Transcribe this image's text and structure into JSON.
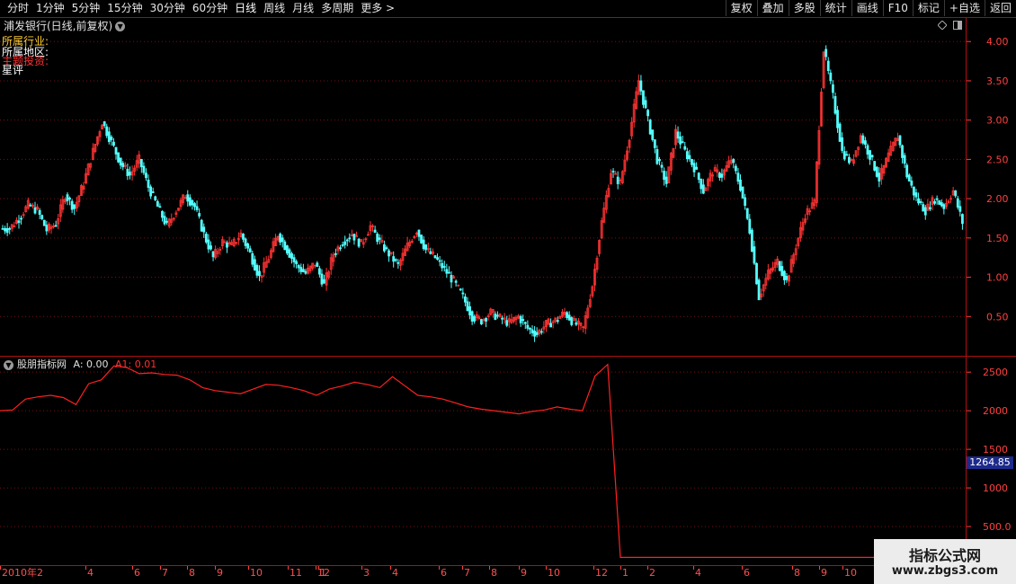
{
  "toolbar": {
    "periods": [
      "分时",
      "1分钟",
      "5分钟",
      "15分钟",
      "30分钟",
      "60分钟",
      "日线",
      "周线",
      "月线",
      "多周期",
      "更多 >"
    ],
    "active_period": "日线",
    "actions": [
      "复权",
      "叠加",
      "多股",
      "统计",
      "画线",
      "F10",
      "标记",
      "+自选",
      "返回"
    ]
  },
  "main": {
    "title": "浦发银行(日线,前复权)",
    "info_lines": [
      {
        "text": "所属行业:",
        "color": "#ffcc33"
      },
      {
        "text": "所属地区:",
        "color": "#ffffff"
      },
      {
        "text": "主题投资:",
        "color": "#ff3030"
      },
      {
        "text": "星评",
        "color": "#ffffff"
      }
    ]
  },
  "indicator": {
    "name": "股朋指标网",
    "a_label": "A: 0.00",
    "a1_label": "A1: 0.01"
  },
  "price_axis": {
    "ticks": [
      "4.00",
      "3.50",
      "3.00",
      "2.50",
      "2.00",
      "1.50",
      "1.00",
      "0.50"
    ]
  },
  "indicator_axis": {
    "ticks": [
      "2500",
      "2000",
      "1500",
      "1000",
      "500.0"
    ],
    "current_value": "1264.85"
  },
  "date_axis": {
    "labels": [
      "2010年2",
      "4",
      "6",
      "7",
      "8",
      "9",
      "10",
      "11",
      "12",
      "1",
      "3",
      "4",
      "6",
      "7",
      "8",
      "9",
      "10",
      "12",
      "1",
      "2",
      "4",
      "6",
      "8",
      "9",
      "10"
    ]
  },
  "watermark": {
    "line1": "指标公式网",
    "line2": "www.zbgs3.com"
  },
  "colors": {
    "up": "#ff3333",
    "down": "#54ffff",
    "grid": "#7a1010",
    "axis": "#ff4040",
    "indicator_line": "#ff2020"
  },
  "chart_data": {
    "type": "line",
    "price_series_close": [
      1.62,
      1.75,
      1.92,
      1.85,
      1.6,
      1.68,
      2.05,
      1.88,
      2.2,
      2.6,
      2.98,
      2.72,
      2.45,
      2.3,
      2.5,
      2.15,
      1.9,
      1.65,
      1.85,
      2.05,
      1.9,
      1.55,
      1.25,
      1.45,
      1.4,
      1.55,
      1.3,
      1.0,
      1.25,
      1.55,
      1.35,
      1.15,
      1.05,
      1.18,
      0.9,
      1.3,
      1.45,
      1.55,
      1.42,
      1.65,
      1.45,
      1.3,
      1.15,
      1.4,
      1.6,
      1.35,
      1.25,
      1.1,
      0.95,
      0.75,
      0.5,
      0.45,
      0.55,
      0.48,
      0.42,
      0.5,
      0.35,
      0.28,
      0.4,
      0.45,
      0.55,
      0.42,
      0.35,
      0.9,
      1.7,
      2.35,
      2.2,
      2.8,
      3.5,
      3.0,
      2.5,
      2.2,
      2.85,
      2.6,
      2.4,
      2.1,
      2.35,
      2.3,
      2.5,
      2.15,
      1.6,
      0.75,
      1.05,
      1.2,
      0.95,
      1.4,
      1.8,
      1.95,
      3.9,
      3.3,
      2.6,
      2.45,
      2.8,
      2.55,
      2.25,
      2.55,
      2.8,
      2.3,
      2.0,
      1.85,
      2.0,
      1.9,
      2.1,
      1.7
    ],
    "indicator_series": [
      2000,
      2010,
      2150,
      2180,
      2200,
      2170,
      2080,
      2350,
      2400,
      2580,
      2560,
      2480,
      2490,
      2470,
      2460,
      2400,
      2300,
      2260,
      2240,
      2220,
      2280,
      2340,
      2330,
      2300,
      2260,
      2200,
      2280,
      2320,
      2370,
      2340,
      2300,
      2440,
      2320,
      2200,
      2180,
      2150,
      2100,
      2050,
      2020,
      2000,
      1980,
      1960,
      1990,
      2010,
      2050,
      2020,
      2000,
      2450,
      2600,
      100,
      100,
      100,
      100,
      100,
      100,
      100,
      100,
      100,
      100,
      100
    ],
    "ylim_price": [
      0,
      4.3
    ],
    "ylim_indicator": [
      0,
      2700
    ]
  }
}
